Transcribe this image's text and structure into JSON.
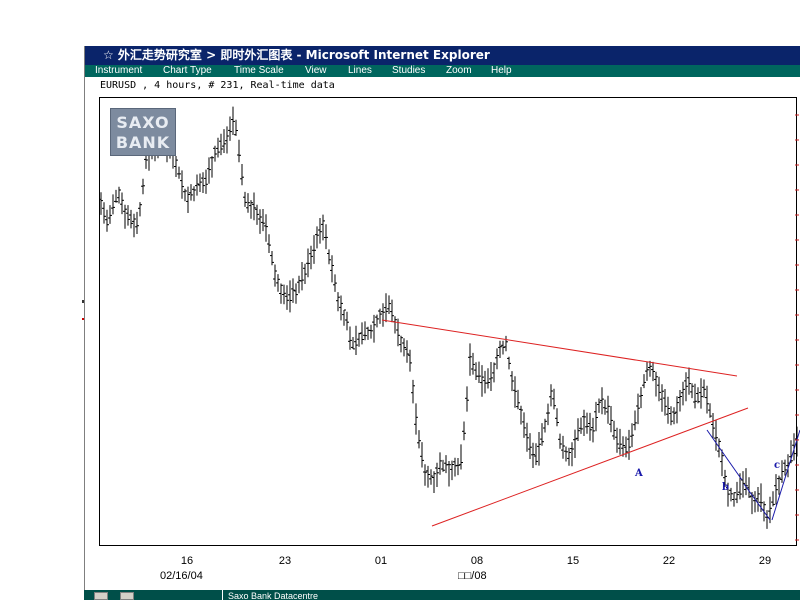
{
  "window": {
    "title": "☆ 外汇走势研究室 > 即时外汇图表 - Microsoft Internet Explorer",
    "title_icon": "star-icon"
  },
  "menubar": {
    "items": [
      "Instrument",
      "Chart Type",
      "Time Scale",
      "View",
      "Lines",
      "Studies",
      "Zoom",
      "Help"
    ]
  },
  "chart_header": "EURUSD , 4 hours, # 231, Real-time data",
  "logo": {
    "line1": "SAXO",
    "line2": "BANK"
  },
  "statusbar": {
    "text": "Saxo Bank Datacentre"
  },
  "colors": {
    "titlebar": "#0a246a",
    "menubar": "#00665e",
    "trendline": "#dd2222",
    "annotation": "#1a1aaa",
    "candle": "#000000"
  },
  "chart_data": {
    "type": "ohlc",
    "symbol": "EURUSD",
    "timeframe": "4 hours",
    "x_tick_labels": [
      "16",
      "23",
      "01",
      "08",
      "15",
      "22",
      "29"
    ],
    "x_sub_labels": [
      "02/16/04",
      "□□/08"
    ],
    "annotations": [
      "A",
      "b",
      "c"
    ],
    "trendlines": [
      {
        "name": "upper",
        "from_tick": "01",
        "to_tick": "29"
      },
      {
        "name": "lower",
        "from_tick": "01",
        "to_tick": "29"
      }
    ],
    "grid": false
  }
}
